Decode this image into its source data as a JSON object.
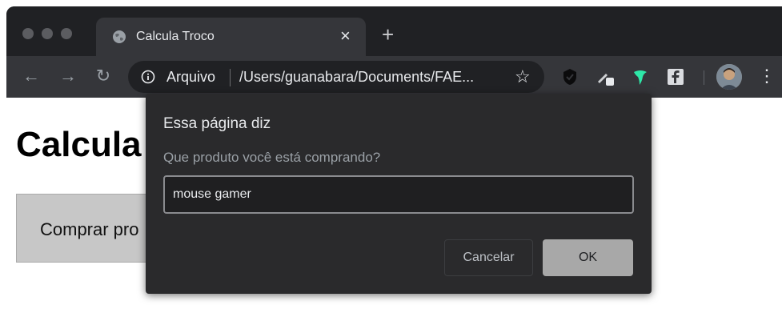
{
  "browser": {
    "tab": {
      "title": "Calcula Troco",
      "close_glyph": "×"
    },
    "new_tab_glyph": "+",
    "toolbar": {
      "back_glyph": "←",
      "forward_glyph": "→",
      "reload_glyph": "↻",
      "omnibox": {
        "scheme_label": "Arquivo",
        "url": "/Users/guanabara/Documents/FAE..."
      },
      "star_glyph": "☆",
      "extensions": [
        "shield-icon",
        "pen-icon",
        "bird-icon",
        "facebook-icon"
      ],
      "menu_glyph": "⋮"
    }
  },
  "page": {
    "heading": "Calcula",
    "button_label": "Comprar pro"
  },
  "dialog": {
    "title": "Essa página diz",
    "message": "Que produto você está comprando?",
    "input_value": "mouse gamer",
    "cancel_label": "Cancelar",
    "ok_label": "OK"
  },
  "colors": {
    "chrome_dark": "#202124",
    "toolbar": "#35363a",
    "dialog_bg": "#2a2a2c",
    "ok_button": "#a8a8a8",
    "page_button": "#c7c7c7"
  }
}
